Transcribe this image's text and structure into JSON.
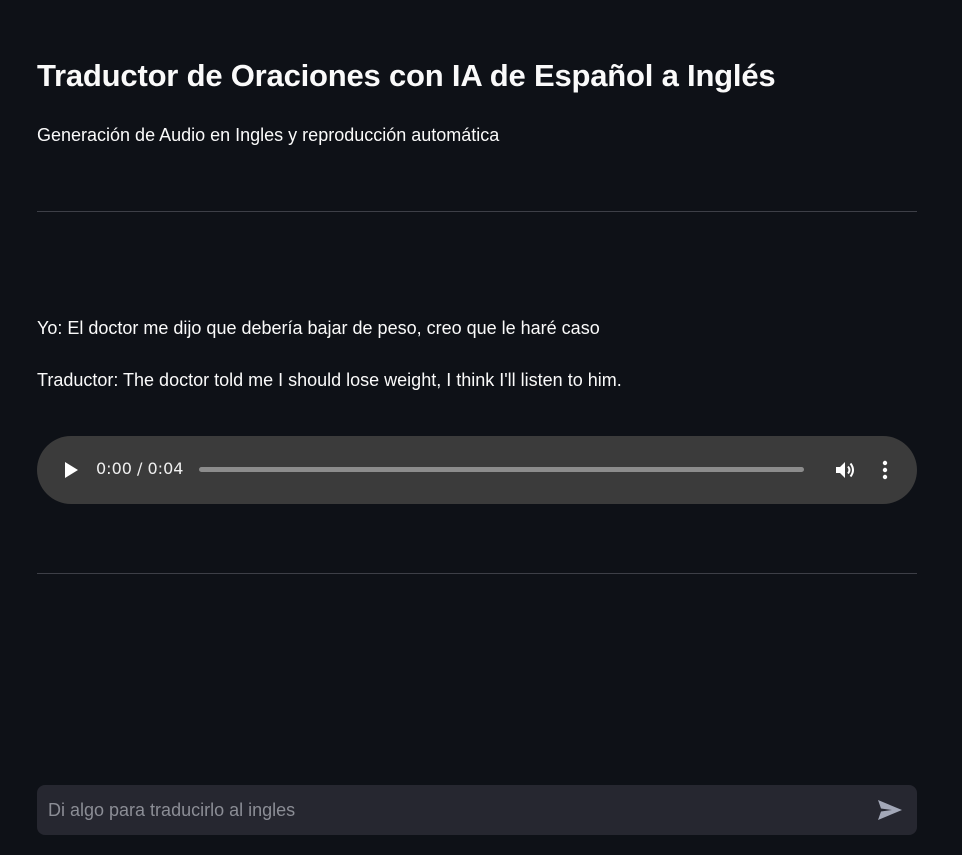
{
  "header": {
    "title": "Traductor de Oraciones con IA de Español a Inglés",
    "subtitle": "Generación de Audio en Ingles y reproducción automática"
  },
  "messages": [
    {
      "text": "Yo: El doctor me dijo que debería bajar de peso, creo que le haré caso"
    },
    {
      "text": "Traductor: The doctor told me I should lose weight, I think I'll listen to him."
    }
  ],
  "audio_player": {
    "time_display": "0:00 / 0:04",
    "progress": 0,
    "icons": {
      "play": "play-icon",
      "volume": "volume-icon",
      "more": "more-vertical-icon"
    }
  },
  "chat_input": {
    "placeholder": "Di algo para traducirlo al ingles",
    "value": "",
    "send_icon": "send-icon"
  },
  "colors": {
    "background": "#0e1117",
    "text": "#fafafa",
    "divider": "#3d3f47",
    "audio_bg": "#3b3b3b",
    "input_bg": "#262730",
    "placeholder": "#8b8d95"
  }
}
